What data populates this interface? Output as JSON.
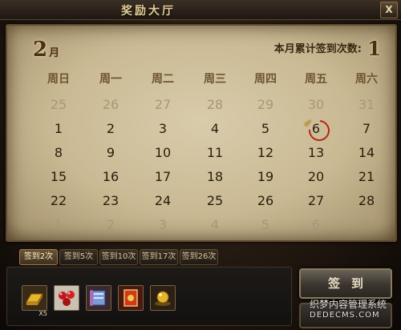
{
  "window": {
    "title": "奖励大厅",
    "close_label": "X"
  },
  "calendar": {
    "month_number": "2",
    "month_unit": "月",
    "count_label": "本月累计签到次数:",
    "count_value": "1",
    "weekdays": [
      "周日",
      "周一",
      "周二",
      "周三",
      "周四",
      "周五",
      "周六"
    ],
    "weeks": [
      [
        "25",
        "26",
        "27",
        "28",
        "29",
        "30",
        "31"
      ],
      [
        "1",
        "2",
        "3",
        "4",
        "5",
        "6",
        "7"
      ],
      [
        "8",
        "9",
        "10",
        "11",
        "12",
        "13",
        "14"
      ],
      [
        "15",
        "16",
        "17",
        "18",
        "19",
        "20",
        "21"
      ],
      [
        "22",
        "23",
        "24",
        "25",
        "26",
        "27",
        "28"
      ],
      [
        "1",
        "2",
        "3",
        "4",
        "5",
        "6",
        "7"
      ]
    ],
    "other_month_rows": [
      0,
      5
    ],
    "signed_day": "6"
  },
  "tabs": [
    "签到2次",
    "签到5次",
    "签到10次",
    "签到17次",
    "签到26次"
  ],
  "active_tab": 0,
  "rewards": [
    {
      "icon": "gold-bar-icon",
      "qty": "X5"
    },
    {
      "icon": "red-gems-icon",
      "qty": ""
    },
    {
      "icon": "scroll-icon",
      "qty": ""
    },
    {
      "icon": "card-icon",
      "qty": ""
    },
    {
      "icon": "golden-orb-icon",
      "qty": ""
    }
  ],
  "sign_button": "签到",
  "watermark": {
    "line1": "织梦内容管理系统",
    "line2": "DEDECMS.COM"
  }
}
